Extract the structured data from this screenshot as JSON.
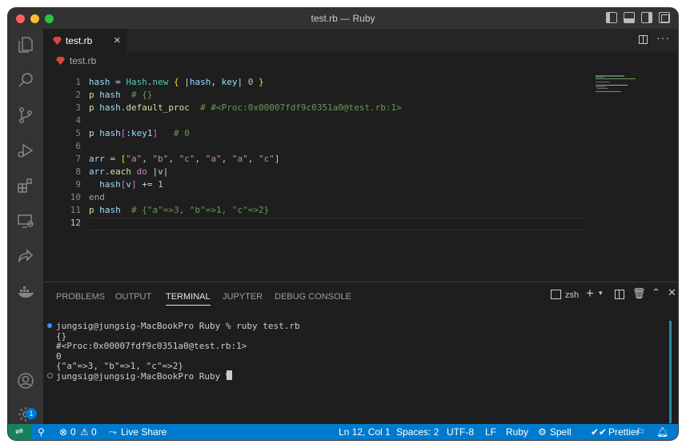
{
  "window": {
    "title": "test.rb — Ruby",
    "traffic_lights": [
      "#ff5f57",
      "#febc2e",
      "#28c840"
    ]
  },
  "activity_bar": {
    "items": [
      "explorer-icon",
      "search-icon",
      "source-control-icon",
      "run-debug-icon",
      "extensions-icon",
      "remote-explorer-icon",
      "live-share-icon",
      "docker-icon"
    ],
    "bottom": [
      "account-icon",
      "settings-gear-icon"
    ],
    "settings_badge": "1"
  },
  "tab": {
    "label": "test.rb",
    "close": "×"
  },
  "breadcrumb": {
    "file": "test.rb"
  },
  "editor": {
    "lines": [
      {
        "n": "1",
        "tokens": [
          [
            "hash",
            "#9cdcfe"
          ],
          [
            " = ",
            "#d4d4d4"
          ],
          [
            "Hash",
            "#4ec9b0"
          ],
          [
            ".",
            "#d4d4d4"
          ],
          [
            "new",
            "#4ec9b0"
          ],
          [
            " ",
            "#d4d4d4"
          ],
          [
            "{",
            "#ffd700"
          ],
          [
            " |",
            "#d4d4d4"
          ],
          [
            "hash",
            "#9cdcfe"
          ],
          [
            ", ",
            "#d4d4d4"
          ],
          [
            "key",
            "#9cdcfe"
          ],
          [
            "| ",
            "#d4d4d4"
          ],
          [
            "0",
            "#b5cea8"
          ],
          [
            " ",
            "#d4d4d4"
          ],
          [
            "}",
            "#ffd700"
          ]
        ]
      },
      {
        "n": "2",
        "tokens": [
          [
            "p",
            "#dcdcaa"
          ],
          [
            " ",
            "#d4d4d4"
          ],
          [
            "hash",
            "#9cdcfe"
          ],
          [
            "  # {}",
            "#6a9955"
          ]
        ]
      },
      {
        "n": "3",
        "tokens": [
          [
            "p",
            "#dcdcaa"
          ],
          [
            " ",
            "#d4d4d4"
          ],
          [
            "hash",
            "#9cdcfe"
          ],
          [
            ".",
            "#d4d4d4"
          ],
          [
            "default_proc",
            "#dcdcaa"
          ],
          [
            "  # #<Proc:0x00007fdf9c0351a0@test.rb:1>",
            "#6a9955"
          ]
        ]
      },
      {
        "n": "4",
        "tokens": []
      },
      {
        "n": "5",
        "tokens": [
          [
            "p",
            "#dcdcaa"
          ],
          [
            " ",
            "#d4d4d4"
          ],
          [
            "hash",
            "#9cdcfe"
          ],
          [
            "[",
            "#da70d6"
          ],
          [
            ":key1",
            "#9cdcfe"
          ],
          [
            "]",
            "#da70d6"
          ],
          [
            "   # 0",
            "#6a9955"
          ]
        ]
      },
      {
        "n": "6",
        "tokens": []
      },
      {
        "n": "7",
        "tokens": [
          [
            "arr",
            "#9cdcfe"
          ],
          [
            " = ",
            "#d4d4d4"
          ],
          [
            "[",
            "#ffd700"
          ],
          [
            "\"a\"",
            "#ce9178"
          ],
          [
            ", ",
            "#d4d4d4"
          ],
          [
            "\"b\"",
            "#ce9178"
          ],
          [
            ", ",
            "#d4d4d4"
          ],
          [
            "\"c\"",
            "#ce9178"
          ],
          [
            ", ",
            "#d4d4d4"
          ],
          [
            "\"a\"",
            "#ce9178"
          ],
          [
            ", ",
            "#d4d4d4"
          ],
          [
            "\"a\"",
            "#ce9178"
          ],
          [
            ", ",
            "#d4d4d4"
          ],
          [
            "\"c\"",
            "#ce9178"
          ],
          [
            "]",
            "#ffd700"
          ]
        ]
      },
      {
        "n": "8",
        "tokens": [
          [
            "arr",
            "#9cdcfe"
          ],
          [
            ".",
            "#d4d4d4"
          ],
          [
            "each",
            "#dcdcaa"
          ],
          [
            " ",
            "#d4d4d4"
          ],
          [
            "do",
            "#c586c0"
          ],
          [
            " |",
            "#d4d4d4"
          ],
          [
            "v",
            "#9cdcfe"
          ],
          [
            "|",
            "#d4d4d4"
          ]
        ]
      },
      {
        "n": "9",
        "tokens": [
          [
            "  ",
            "#d4d4d4"
          ],
          [
            "hash",
            "#9cdcfe"
          ],
          [
            "[",
            "#da70d6"
          ],
          [
            "v",
            "#9cdcfe"
          ],
          [
            "]",
            "#da70d6"
          ],
          [
            " += ",
            "#d4d4d4"
          ],
          [
            "1",
            "#b5cea8"
          ]
        ]
      },
      {
        "n": "10",
        "tokens": [
          [
            "end",
            "#c586c0"
          ]
        ]
      },
      {
        "n": "11",
        "tokens": [
          [
            "p",
            "#dcdcaa"
          ],
          [
            " ",
            "#d4d4d4"
          ],
          [
            "hash",
            "#9cdcfe"
          ],
          [
            "  # {\"a\"=>3, \"b\"=>1, \"c\"=>2}",
            "#6a9955"
          ]
        ]
      },
      {
        "n": "12",
        "tokens": []
      }
    ]
  },
  "panel": {
    "tabs": [
      "PROBLEMS",
      "OUTPUT",
      "TERMINAL",
      "JUPYTER",
      "DEBUG CONSOLE"
    ],
    "active_tab": "TERMINAL",
    "shell": "zsh",
    "terminal": [
      "jungsig@jungsig-MacBookPro Ruby % ruby test.rb",
      "{}",
      "#<Proc:0x00007fdf9c0351a0@test.rb:1>",
      "0",
      "{\"a\"=>3, \"b\"=>1, \"c\"=>2}",
      "jungsig@jungsig-MacBookPro Ruby % "
    ]
  },
  "statusbar": {
    "errors": "0",
    "warnings": "0",
    "live_share": "Live Share",
    "position": "Ln 12, Col 1",
    "spaces": "Spaces: 2",
    "encoding": "UTF-8",
    "eol": "LF",
    "language": "Ruby",
    "spell": "Spell",
    "prettier": "Prettier"
  }
}
